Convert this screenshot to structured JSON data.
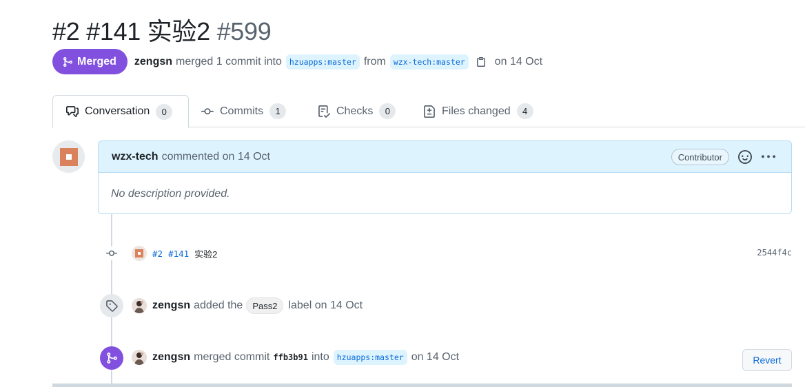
{
  "pr": {
    "title": "#2 #141 实验2",
    "number": "#599",
    "status_label": "Merged",
    "merged_by": "zengsn",
    "merged_text": "merged 1 commit into",
    "base_branch": "hzuapps:master",
    "from_text": "from",
    "head_branch": "wzx-tech:master",
    "merged_date": "on 14 Oct"
  },
  "tabs": [
    {
      "label": "Conversation",
      "count": "0",
      "icon": "comment-discussion-icon"
    },
    {
      "label": "Commits",
      "count": "1",
      "icon": "git-commit-icon"
    },
    {
      "label": "Checks",
      "count": "0",
      "icon": "checklist-icon"
    },
    {
      "label": "Files changed",
      "count": "4",
      "icon": "file-diff-icon"
    }
  ],
  "comment": {
    "author": "wzx-tech",
    "action": "commented on 14 Oct",
    "role": "Contributor",
    "body": "No description provided."
  },
  "timeline": {
    "commit": {
      "link1": "#2",
      "link2": "#141",
      "message": "实验2",
      "sha": "2544f4c"
    },
    "label_event": {
      "author": "zengsn",
      "text1": "added the",
      "label": "Pass2",
      "text2": "label on 14 Oct"
    },
    "merge_event": {
      "author": "zengsn",
      "text1": "merged commit",
      "sha": "ffb3b91",
      "text2": "into",
      "branch": "hzuapps:master",
      "date": "on 14 Oct",
      "revert_label": "Revert"
    }
  },
  "colors": {
    "merged_purple": "#8250df",
    "link_blue": "#0969da",
    "branch_bg": "#ddf4ff",
    "comment_header_bg": "#ddf4ff"
  }
}
